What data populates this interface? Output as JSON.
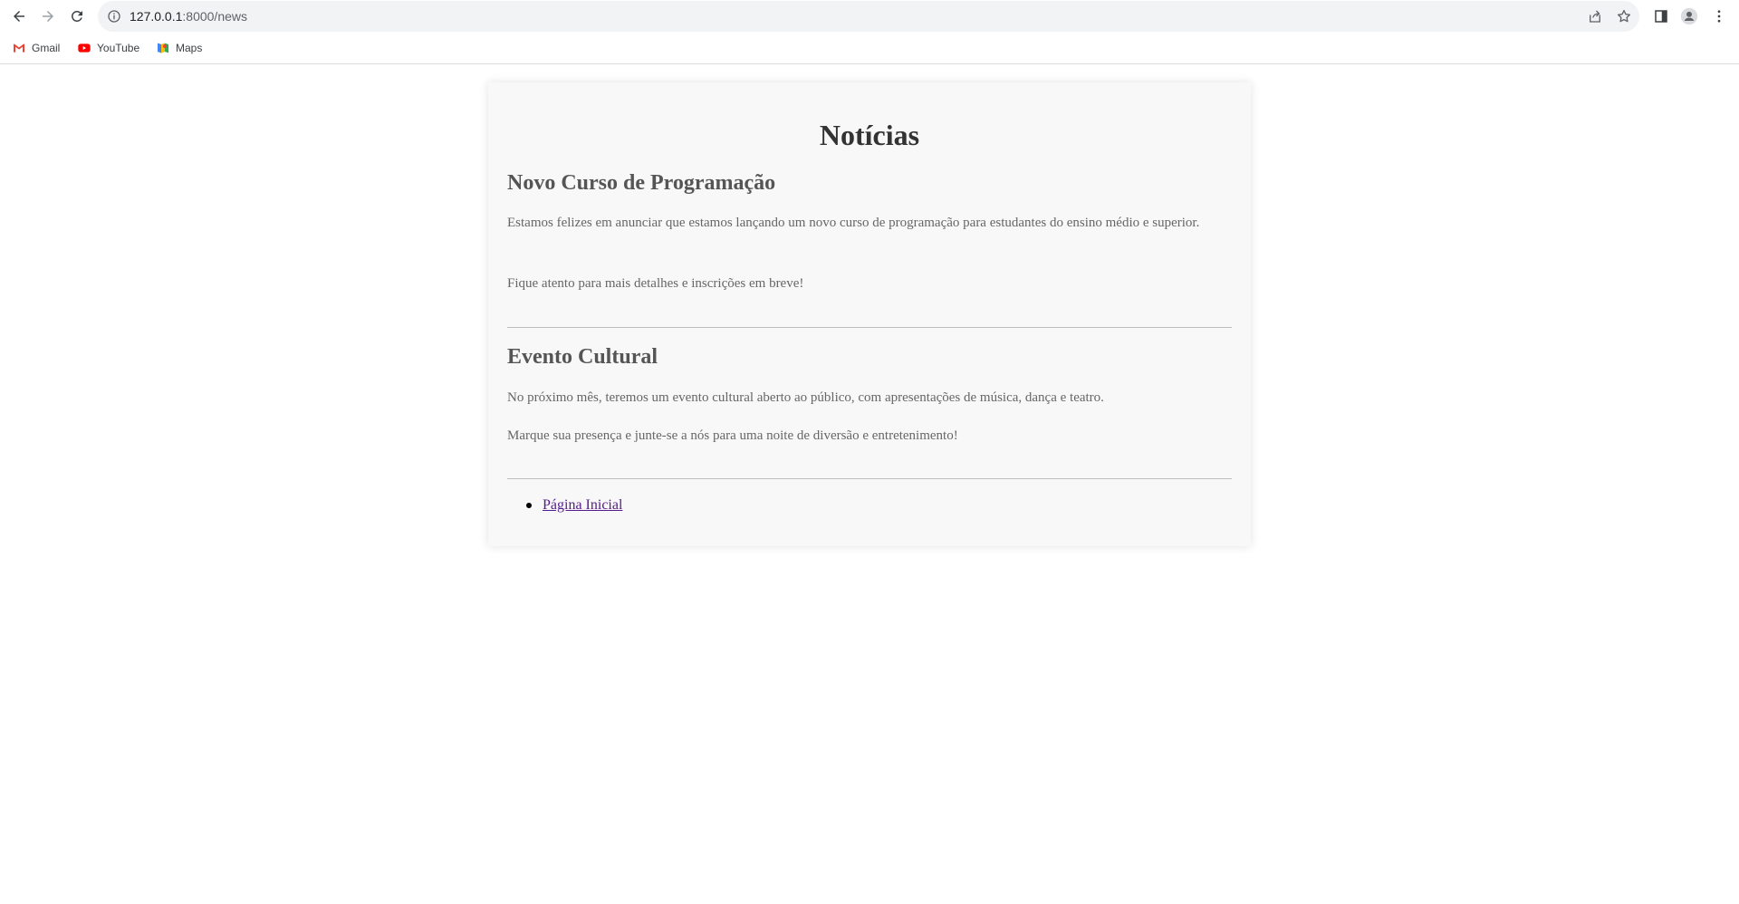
{
  "browser": {
    "url_host": "127.0.0.1",
    "url_path": ":8000/news",
    "bookmarks": [
      {
        "label": "Gmail",
        "icon": "gmail-icon"
      },
      {
        "label": "YouTube",
        "icon": "youtube-icon"
      },
      {
        "label": "Maps",
        "icon": "maps-icon"
      }
    ]
  },
  "page": {
    "title": "Notícias",
    "articles": [
      {
        "title": "Novo Curso de Programação",
        "paragraphs": [
          "Estamos felizes em anunciar que estamos lançando um novo curso de programação para estudantes do ensino médio e superior.",
          "Fique atento para mais detalhes e inscrições em breve!"
        ]
      },
      {
        "title": "Evento Cultural",
        "paragraphs": [
          "No próximo mês, teremos um evento cultural aberto ao público, com apresentações de música, dança e teatro.",
          "Marque sua presença e junte-se a nós para uma noite de diversão e entretenimento!"
        ]
      }
    ],
    "links": [
      {
        "label": "Página Inicial"
      }
    ]
  },
  "colors": {
    "link_visited": "#551a8b",
    "heading": "#333333",
    "subheading": "#555555",
    "text": "#666666",
    "panel_bg": "#f8f8f8"
  }
}
